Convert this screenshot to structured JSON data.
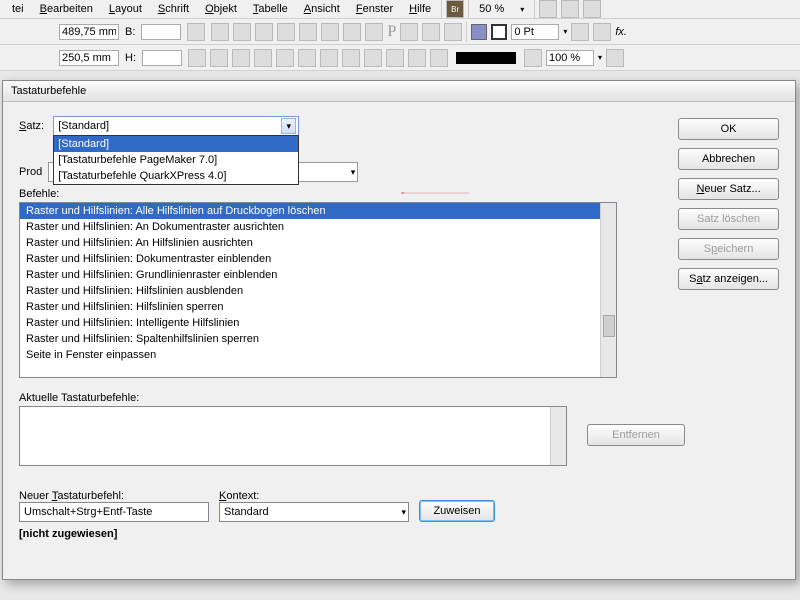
{
  "menu": [
    "tei",
    "Bearbeiten",
    "Layout",
    "Schrift",
    "Objekt",
    "Tabelle",
    "Ansicht",
    "Fenster",
    "Hilfe"
  ],
  "top": {
    "zoom": "50 %",
    "x": "489,75 mm",
    "y": "250,5 mm",
    "b": "B:",
    "h": "H:",
    "stroke": "0 Pt",
    "pct": "100 %"
  },
  "dialog": {
    "title": "Tastaturbefehle",
    "satz_label": "Satz:",
    "satz_value": "[Standard]",
    "satz_options": [
      "[Standard]",
      "[Tastaturbefehle PageMaker 7.0]",
      "[Tastaturbefehle QuarkXPress 4.0]"
    ],
    "prod_prefix": "Prod",
    "befehle_label": "Befehle:",
    "commands": [
      "Raster und Hilfslinien: Alle Hilfslinien auf Druckbogen löschen",
      "Raster und Hilfslinien: An Dokumentraster ausrichten",
      "Raster und Hilfslinien: An Hilfslinien ausrichten",
      "Raster und Hilfslinien: Dokumentraster einblenden",
      "Raster und Hilfslinien: Grundlinienraster einblenden",
      "Raster und Hilfslinien: Hilfslinien ausblenden",
      "Raster und Hilfslinien: Hilfslinien sperren",
      "Raster und Hilfslinien: Intelligente Hilfslinien",
      "Raster und Hilfslinien: Spaltenhilfslinien sperren",
      "Seite in Fenster einpassen"
    ],
    "aktuelle_label": "Aktuelle Tastaturbefehle:",
    "entfernen": "Entfernen",
    "neuer_label": "Neuer Tastaturbefehl:",
    "neuer_value": "Umschalt+Strg+Entf-Taste",
    "kontext_label": "Kontext:",
    "kontext_value": "Standard",
    "zuweisen": "Zuweisen",
    "status": "[nicht zugewiesen]",
    "buttons": {
      "ok": "OK",
      "abbrechen": "Abbrechen",
      "neuer_satz": "Neuer Satz...",
      "satz_loeschen": "Satz löschen",
      "speichern": "Speichern",
      "satz_anzeigen": "Satz anzeigen..."
    }
  }
}
